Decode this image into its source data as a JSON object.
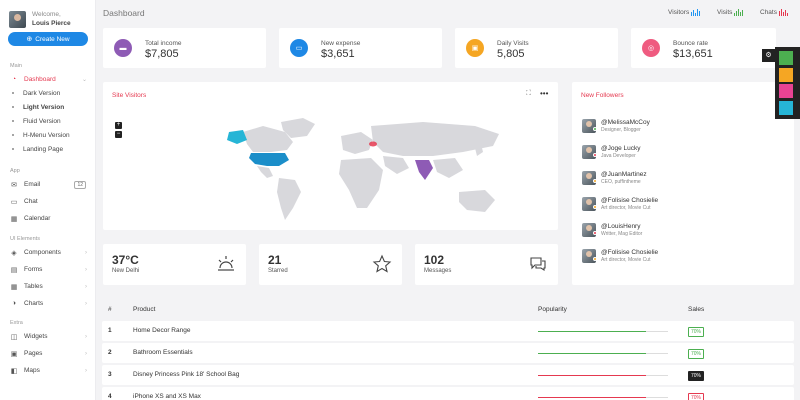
{
  "user": {
    "welcome": "Welcome,",
    "name": "Louis Pierce"
  },
  "create_button": "Create New",
  "sidebar": {
    "sections": {
      "main": "Main",
      "app": "App",
      "ui": "UI Elements",
      "extra": "Extra"
    },
    "dashboard": "Dashboard",
    "dashboard_sub": [
      "Dark Version",
      "Light Version",
      "Fluid Version",
      "H-Menu Version",
      "Landing Page"
    ],
    "app_items": [
      {
        "label": "Email",
        "icon": "mail-icon",
        "badge": "12"
      },
      {
        "label": "Chat",
        "icon": "chat-icon"
      },
      {
        "label": "Calendar",
        "icon": "calendar-icon"
      }
    ],
    "ui_items": [
      {
        "label": "Components",
        "icon": "diamond-icon"
      },
      {
        "label": "Forms",
        "icon": "forms-icon"
      },
      {
        "label": "Tables",
        "icon": "table-icon"
      },
      {
        "label": "Charts",
        "icon": "chart-icon"
      }
    ],
    "extra_items": [
      {
        "label": "Widgets",
        "icon": "widgets-icon"
      },
      {
        "label": "Pages",
        "icon": "pages-icon"
      },
      {
        "label": "Maps",
        "icon": "map-icon"
      }
    ]
  },
  "header": {
    "title": "Dashboard",
    "stats": [
      {
        "label": "Visitors",
        "color": "#2196f3"
      },
      {
        "label": "Visits",
        "color": "#4caf50"
      },
      {
        "label": "Chats",
        "color": "#e53950"
      }
    ]
  },
  "stats": [
    {
      "label": "Total income",
      "value": "$7,805",
      "color": "#8e5bb5",
      "icon": "wallet-icon"
    },
    {
      "label": "New expense",
      "value": "$3,651",
      "color": "#1e88e5",
      "icon": "card-icon"
    },
    {
      "label": "Daily Visits",
      "value": "5,805",
      "color": "#f5a623",
      "icon": "bag-icon"
    },
    {
      "label": "Bounce rate",
      "value": "$13,651",
      "color": "#ef5b80",
      "icon": "target-icon"
    }
  ],
  "site_visitors": {
    "title": "Site Visitors"
  },
  "weather": {
    "value": "37°C",
    "label": "New Delhi"
  },
  "starred": {
    "value": "21",
    "label": "Starred"
  },
  "messages": {
    "value": "102",
    "label": "Messages"
  },
  "followers": {
    "title": "New Followers",
    "items": [
      {
        "name": "@MelissaMcCoy",
        "role": "Designer, Blogger"
      },
      {
        "name": "@Joge Lucky",
        "role": "Java Developer"
      },
      {
        "name": "@JuanMartinez",
        "role": "CEO, puffinthemе"
      },
      {
        "name": "@Folisise Chosielie",
        "role": "Art director, Movie Cut"
      },
      {
        "name": "@LouisHenry",
        "role": "Writter, Mag Editor"
      },
      {
        "name": "@Folisise Chosielie",
        "role": "Art director, Movie Cut"
      }
    ]
  },
  "table": {
    "headers": {
      "num": "#",
      "product": "Product",
      "popularity": "Popularity",
      "sales": "Sales"
    },
    "rows": [
      {
        "num": "1",
        "product": "Home Decor Range",
        "popularity": 0.83,
        "bar_color": "#4caf50",
        "sales": "70%",
        "sales_style": "green"
      },
      {
        "num": "2",
        "product": "Bathroom Essentials",
        "popularity": 0.83,
        "bar_color": "#4caf50",
        "sales": "70%",
        "sales_style": "green"
      },
      {
        "num": "3",
        "product": "Disney Princess Pink 18' School Bag",
        "popularity": 0.83,
        "bar_color": "#e53950",
        "sales": "70%",
        "sales_style": "dark"
      },
      {
        "num": "4",
        "product": "iPhone XS and XS Max",
        "popularity": 0.83,
        "bar_color": "#e53950",
        "sales": "70%",
        "sales_style": "red"
      }
    ]
  },
  "palette": [
    "#4caf50",
    "#f5a623",
    "#e84393",
    "#26b5d6"
  ]
}
